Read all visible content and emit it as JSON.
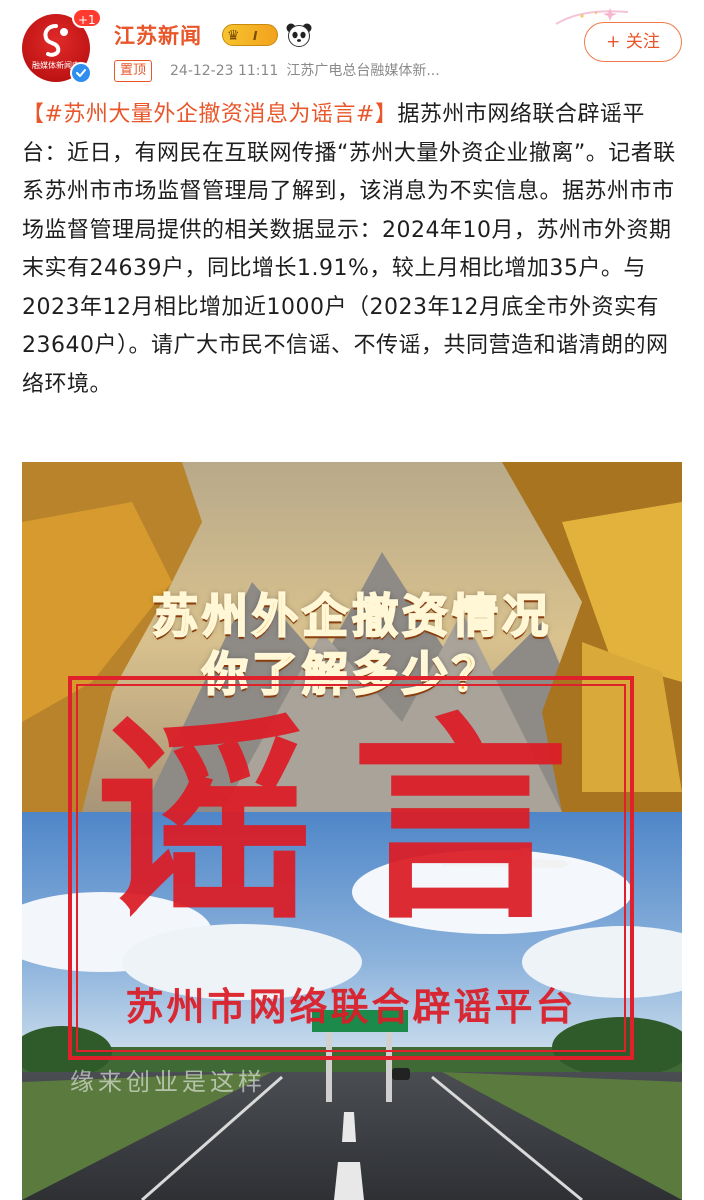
{
  "account": {
    "name": "江苏新闻",
    "avatar_text": "融媒体新闻中",
    "notification_count": "+1",
    "level_badge": "I",
    "verified": true
  },
  "post": {
    "pin_label": "置顶",
    "timestamp": "24-12-23 11:11",
    "source": "江苏广电总台融媒体新...",
    "follow_label": "+ 关注",
    "hashtag": "【#苏州大量外企撤资消息为谣言#】",
    "text": "据苏州市网络联合辟谣平台：近日，有网民在互联网传播“苏州大量外资企业撤离”。记者联系苏州市市场监督管理局了解到，该消息为不实信息。据苏州市市场监督管理局提供的相关数据显示：2024年10月，苏州市外资期末实有24639户，同比增长1.91%，较上月相比增加35户。与2023年12月相比增加近1000户（2023年12月底全市外资实有23640户）。请广大市民不信谣、不传谣，共同营造和谐清朗的网络环境。"
  },
  "media": {
    "title_line_1": "苏州外企撤资情况",
    "title_line_2": "你了解多少？",
    "stamp_main": "谣言",
    "stamp_sub": "苏州市网络联合辟谣平台",
    "sign_text": "缘来创业是这样"
  },
  "colors": {
    "brand": "#e8562a",
    "stamp_red": "#dc1c26",
    "verify_blue": "#2f8ff0"
  },
  "icons": [
    "crown-icon",
    "panda-icon",
    "verified-icon",
    "sparkle-icon",
    "plus-icon"
  ]
}
